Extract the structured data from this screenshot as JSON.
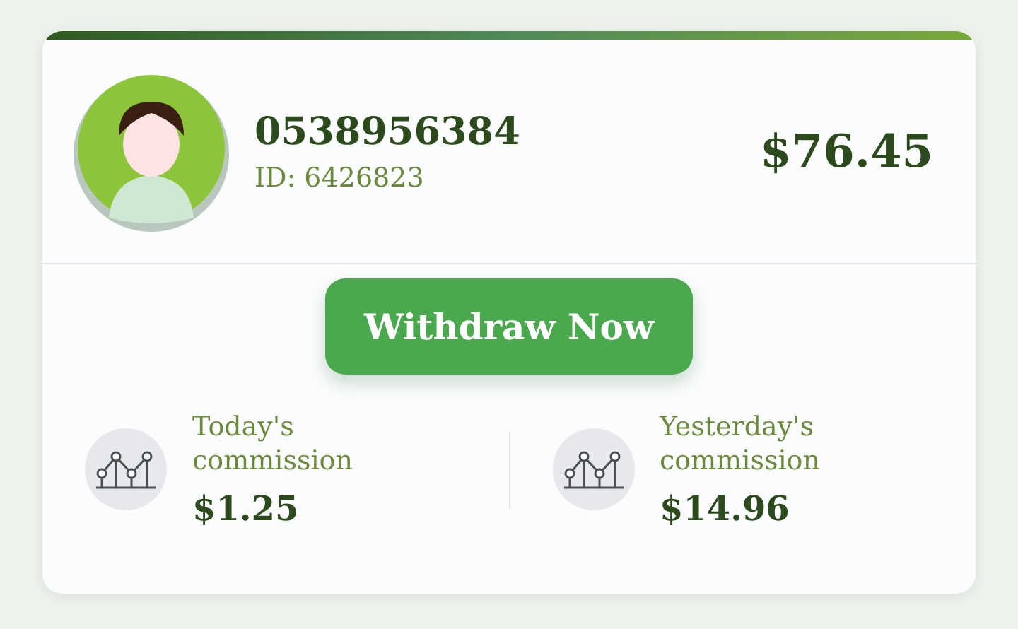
{
  "account": {
    "phone": "0538956384",
    "id_label": "ID: 6426823",
    "balance": "$76.45"
  },
  "withdraw_button": {
    "label": "Withdraw Now"
  },
  "commissions": [
    {
      "label": "Today's commission",
      "amount": "$1.25"
    },
    {
      "label": "Yesterday's commission",
      "amount": "$14.96"
    }
  ]
}
